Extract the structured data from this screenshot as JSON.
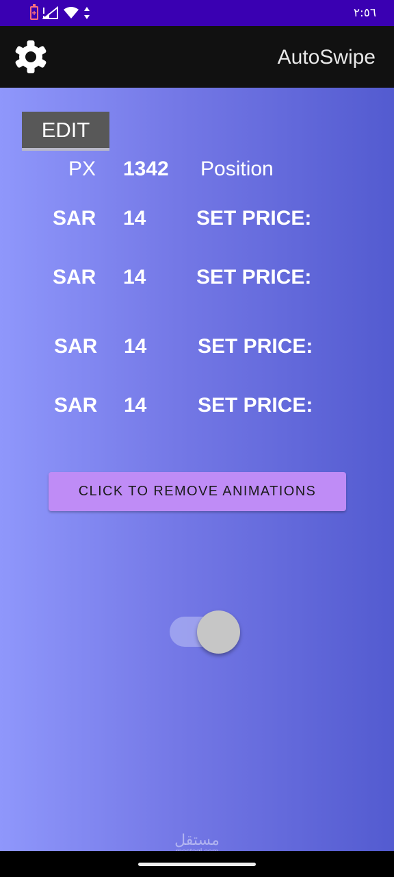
{
  "status_bar": {
    "time": "٢:٥٦",
    "icons": [
      "battery-charging-icon",
      "signal-icon",
      "wifi-icon",
      "data-transfer-icon"
    ]
  },
  "app_bar": {
    "title": "AutoSwipe",
    "settings_icon": "gear-icon"
  },
  "main": {
    "edit_label": "EDIT",
    "position_row": {
      "unit": "PX",
      "value": "1342",
      "label": "Position"
    },
    "price_rows": [
      {
        "currency": "SAR",
        "value": "14",
        "label": "SET PRICE:"
      },
      {
        "currency": "SAR",
        "value": "14",
        "label": "SET PRICE:"
      },
      {
        "currency": "SAR",
        "value": "14",
        "label": "SET PRICE:"
      },
      {
        "currency": "SAR",
        "value": "14",
        "label": "SET PRICE:"
      }
    ],
    "remove_animations_label": "CLICK TO REMOVE ANIMATIONS",
    "toggle_on": true
  },
  "watermark": {
    "arabic": "مستقل",
    "latin": "mostaql.com"
  },
  "colors": {
    "status_bar": "#3a00b2",
    "app_bar": "#111111",
    "gradient_start": "#8f97fb",
    "gradient_end": "#535bd0",
    "remove_button": "#bf8cf6",
    "edit_button": "#585858"
  }
}
